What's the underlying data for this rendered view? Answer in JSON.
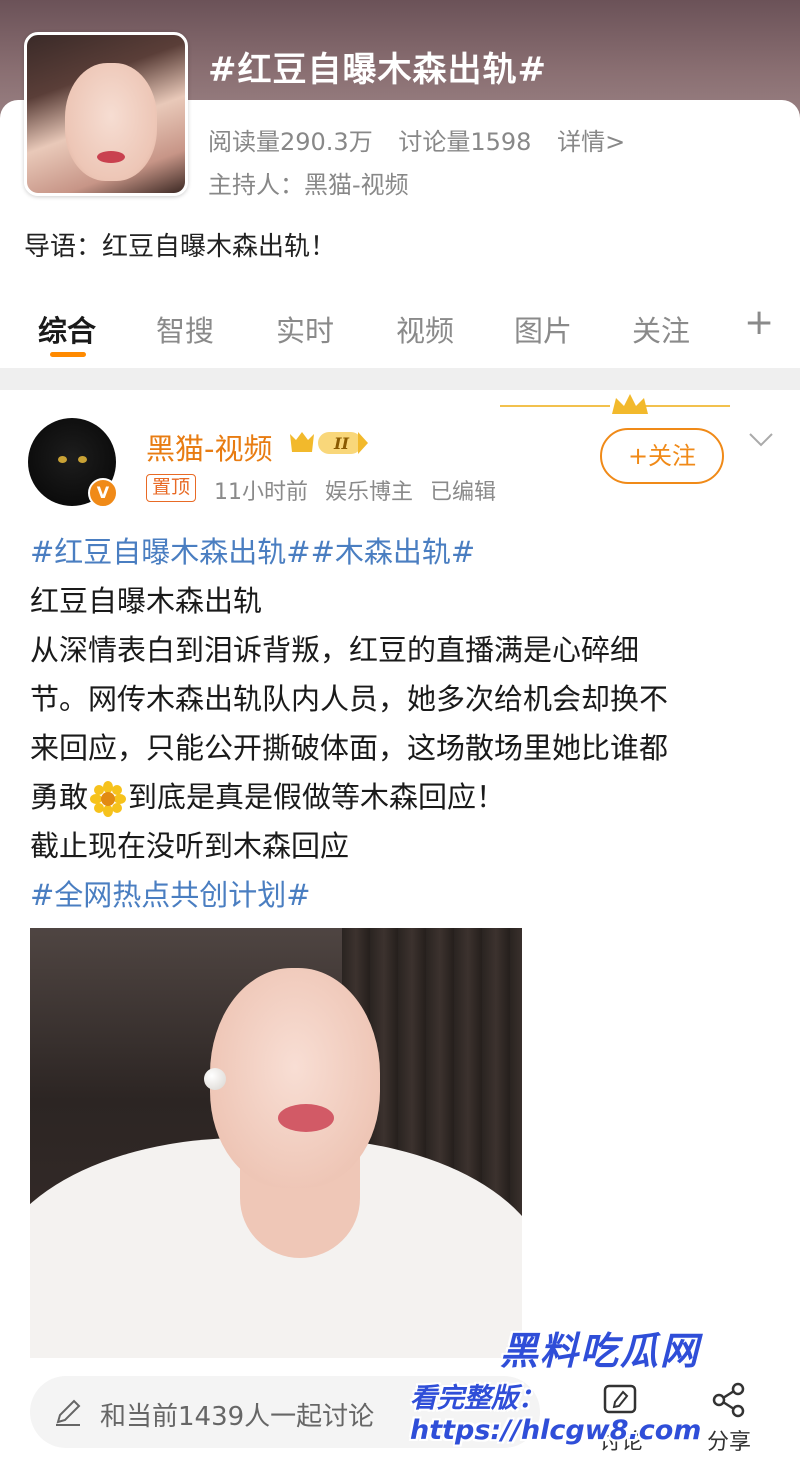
{
  "topic": {
    "title": "#红豆自曝木森出轨#",
    "reads": "阅读量290.3万",
    "discussions": "讨论量1598",
    "details_link": "详情>",
    "host": "主持人：黑猫-视频",
    "intro": "导语：红豆自曝木森出轨！"
  },
  "tabs": [
    {
      "label": "综合",
      "active": true
    },
    {
      "label": "智搜",
      "active": false
    },
    {
      "label": "实时",
      "active": false
    },
    {
      "label": "视频",
      "active": false
    },
    {
      "label": "图片",
      "active": false
    },
    {
      "label": "关注",
      "active": false
    },
    {
      "label": "+",
      "active": false
    }
  ],
  "post": {
    "username": "黑猫-视频",
    "pinned": "置顶",
    "time": "11小时前",
    "role": "娱乐博主",
    "edited": "已编辑",
    "follow": "+关注",
    "hashtags_top": "#红豆自曝木森出轨##木森出轨#",
    "line1": "红豆自曝木森出轨",
    "line2": "从深情表白到泪诉背叛，红豆的直播满是心碎细",
    "line3": "节。网传木森出轨队内人员，她多次给机会却换不",
    "line4": "来回应，只能公开撕破体面，这场散场里她比谁都",
    "line5_a": "勇敢",
    "line5_b": "到底是真是假做等木森回应！",
    "line6": "截止现在没听到木森回应",
    "hashtag_bottom": "#全网热点共创计划#"
  },
  "bottom_bar": {
    "input_placeholder": "和当前1439人一起讨论",
    "discuss_label": "讨论",
    "share_label": "分享"
  },
  "watermark": {
    "title": "黑料吃瓜网",
    "url": "看完整版：https://hlcgw8.com"
  },
  "colors": {
    "accent_orange": "#f08a18",
    "hashtag_blue": "#4a7ec1",
    "username_orange": "#e87c12",
    "watermark_blue": "#2f4ed8"
  },
  "icons": [
    "pen-icon",
    "discuss-icon",
    "share-icon",
    "crown-icon",
    "chevron-down-icon",
    "flower-emoji-icon",
    "verified-badge-icon"
  ]
}
